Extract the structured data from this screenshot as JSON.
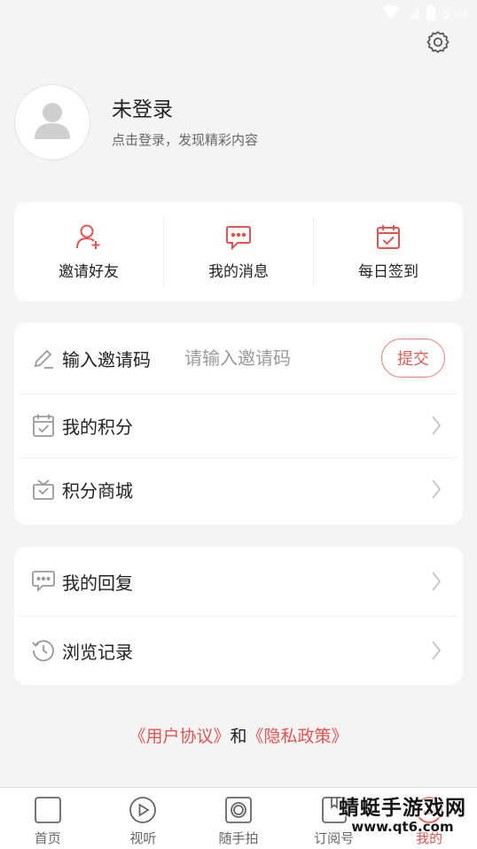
{
  "status_bar": {
    "time": "5:09"
  },
  "profile": {
    "title": "未登录",
    "subtitle": "点击登录，发现精彩内容"
  },
  "quick_actions": [
    {
      "label": "邀请好友",
      "icon": "add-user-icon"
    },
    {
      "label": "我的消息",
      "icon": "message-icon"
    },
    {
      "label": "每日签到",
      "icon": "calendar-check-icon"
    }
  ],
  "invite": {
    "label": "输入邀请码",
    "placeholder": "请输入邀请码",
    "value": "",
    "submit_label": "提交"
  },
  "menu_group_1": [
    {
      "label": "我的积分",
      "icon": "calendar-check-icon"
    },
    {
      "label": "积分商城",
      "icon": "gift-icon"
    }
  ],
  "menu_group_2": [
    {
      "label": "我的回复",
      "icon": "comment-icon"
    },
    {
      "label": "浏览记录",
      "icon": "history-icon"
    }
  ],
  "agreement": {
    "user_agreement": "《用户协议》",
    "and": "和",
    "privacy_policy": "《隐私政策》"
  },
  "tabs": [
    {
      "label": "首页",
      "icon": "home-square-icon"
    },
    {
      "label": "视听",
      "icon": "play-circle-icon"
    },
    {
      "label": "随手拍",
      "icon": "camera-icon"
    },
    {
      "label": "订阅号",
      "icon": "bookmark-icon"
    },
    {
      "label": "我的",
      "icon": "smile-icon",
      "active": true
    }
  ],
  "watermark": {
    "main": "蜻蜓手游戏网",
    "url": "www.qt6.com"
  },
  "colors": {
    "accent": "#e4534f",
    "background": "#f4f4f4",
    "card": "#ffffff",
    "icon_gray": "#9a9a9a"
  }
}
